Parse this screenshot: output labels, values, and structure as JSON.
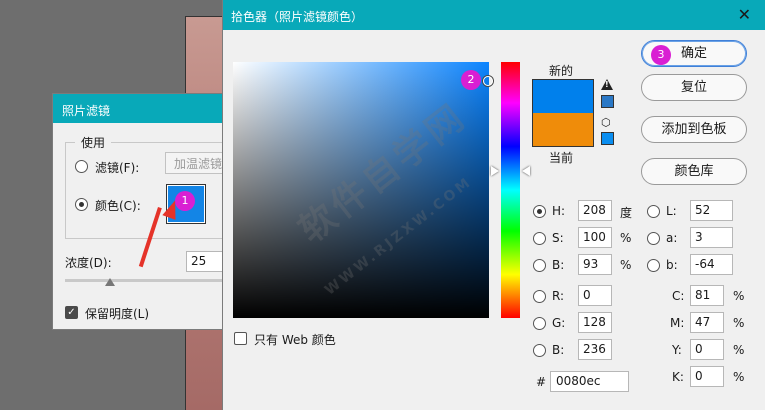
{
  "photo_filter": {
    "title": "照片滤镜",
    "use_group": "使用",
    "filter_label": "滤镜(F):",
    "filter_value": "加温滤镜",
    "color_label": "颜色(C):",
    "color_swatch": "#1385e6",
    "density_label": "浓度(D):",
    "density_value": "25",
    "preserve_label": "保留明度(L)",
    "preserve_checked": "✓"
  },
  "annotations": {
    "badge1": "1",
    "badge2": "2",
    "badge3": "3",
    "badge_color": "#d91fd3",
    "arrow_color": "#e53329"
  },
  "color_picker": {
    "title": "拾色器（照片滤镜颜色）",
    "close_icon": "✕",
    "new_label": "新的",
    "current_label": "当前",
    "new_color": "#0080ec",
    "current_color": "#ef8c0a",
    "buttons": {
      "ok": "确定",
      "reset": "复位",
      "add_swatch": "添加到色板",
      "color_library": "颜色库"
    },
    "web_only_label": "只有 Web 颜色",
    "fields": {
      "H": {
        "label": "H:",
        "value": "208",
        "unit": "度"
      },
      "S": {
        "label": "S:",
        "value": "100",
        "unit": "%"
      },
      "Bv": {
        "label": "B:",
        "value": "93",
        "unit": "%"
      },
      "R": {
        "label": "R:",
        "value": "0"
      },
      "G": {
        "label": "G:",
        "value": "128"
      },
      "Bb": {
        "label": "B:",
        "value": "236"
      },
      "L": {
        "label": "L:",
        "value": "52"
      },
      "a": {
        "label": "a:",
        "value": "3"
      },
      "b": {
        "label": "b:",
        "value": "-64"
      },
      "C": {
        "label": "C:",
        "value": "81",
        "unit": "%"
      },
      "M": {
        "label": "M:",
        "value": "47",
        "unit": "%"
      },
      "Y": {
        "label": "Y:",
        "value": "0",
        "unit": "%"
      },
      "K": {
        "label": "K:",
        "value": "0",
        "unit": "%"
      }
    },
    "hex_label": "#",
    "hex_value": "0080ec"
  },
  "watermark": {
    "main": "软件自学网",
    "sub": "WWW.RJZXW.COM"
  }
}
